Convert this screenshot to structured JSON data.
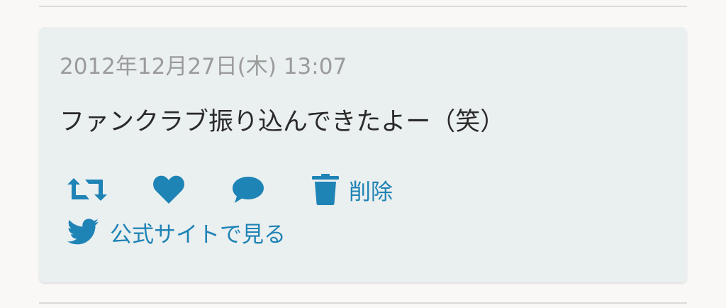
{
  "post": {
    "timestamp": "2012年12月27日(木) 13:07",
    "text": "ファンクラブ振り込んできたよー（笑）",
    "actions": {
      "retweet_icon": "retweet-icon",
      "like_icon": "heart-icon",
      "reply_icon": "speech-bubble-icon",
      "delete_icon": "trash-icon",
      "delete_label": "削除",
      "official_icon": "twitter-bird-icon",
      "official_label": "公式サイトで見る"
    }
  },
  "colors": {
    "accent": "#1e83b5",
    "card_bg": "#eaeff0",
    "page_bg": "#f9f8f6",
    "timestamp": "#9b9b9b",
    "text": "#2a2a2a"
  }
}
